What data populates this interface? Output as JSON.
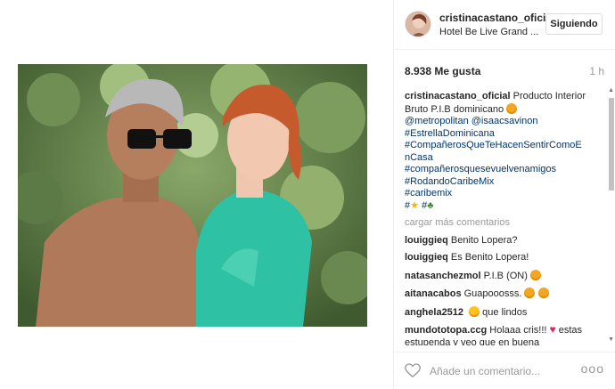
{
  "header": {
    "username": "cristinacastano_ofici...",
    "location": "Hotel Be Live Grand ...",
    "follow_label": "Siguiendo"
  },
  "stats": {
    "likes": "8.938 Me gusta",
    "time": "1 h"
  },
  "caption": {
    "username": "cristinacastano_oficial",
    "text": "Producto Interior Bruto P.I.B dominicano",
    "mentions": "@metropolitan @isaacsavinon",
    "tags": [
      "#EstrellaDominicana",
      "#CompañerosQueTeHacenSentirComoE",
      "nCasa",
      "#compañerosquesevuelvenamigos",
      "#RodandoCaribeMix",
      "#caribemix",
      "#",
      "#"
    ]
  },
  "load_more": "cargar más comentarios",
  "comments": [
    {
      "user": "louiggieq",
      "text": "Benito Lopera?"
    },
    {
      "user": "louiggieq",
      "text": "Es Benito Lopera!"
    },
    {
      "user": "natasanchezmol",
      "text": "P.I.B (ON)"
    },
    {
      "user": "aitanacabos",
      "text": "Guapooosss."
    },
    {
      "user": "anghela2512",
      "text": "que lindos"
    },
    {
      "user": "mundototopa.ccg",
      "text": "Holaaa cris!!!",
      "text2": "estas estupenda y veo que en buena"
    }
  ],
  "footer": {
    "placeholder": "Añade un comentario...",
    "more": "ooo"
  },
  "colors": {
    "link": "#003569",
    "muted": "#999999",
    "border": "#efefef"
  }
}
